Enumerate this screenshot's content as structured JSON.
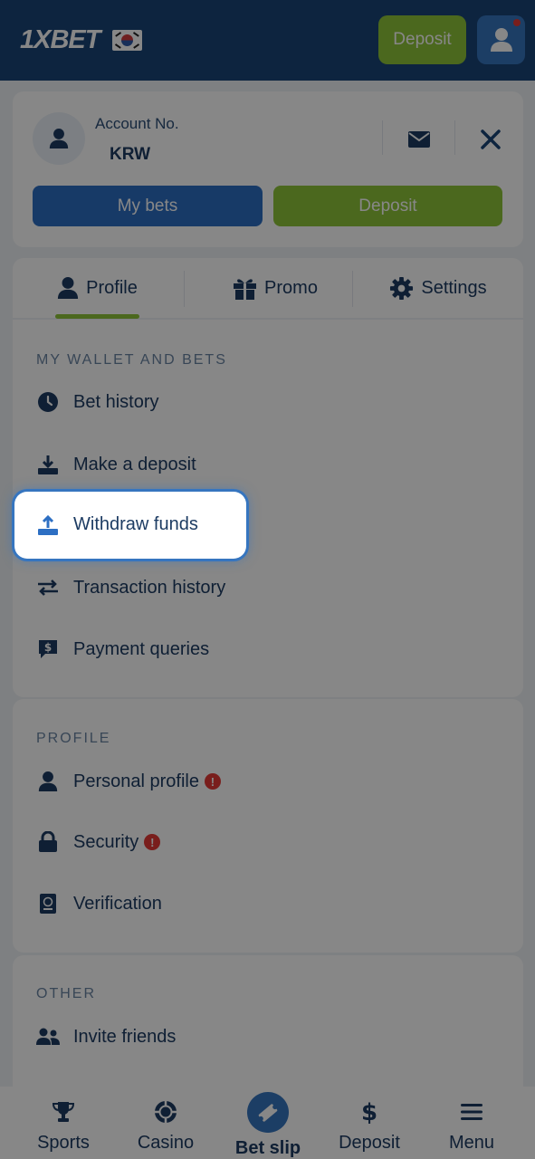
{
  "header": {
    "logo_text": "1XBET",
    "deposit_label": "Deposit"
  },
  "account": {
    "account_label": "Account No.",
    "currency": "KRW",
    "my_bets_label": "My bets",
    "deposit_label": "Deposit"
  },
  "tabs": [
    {
      "label": "Profile",
      "icon": "user-icon",
      "active": true
    },
    {
      "label": "Promo",
      "icon": "gift-icon"
    },
    {
      "label": "Settings",
      "icon": "gear-icon"
    }
  ],
  "wallet": {
    "title": "MY WALLET AND BETS",
    "items": [
      {
        "label": "Bet history",
        "icon": "clock-icon"
      },
      {
        "label": "Make a deposit",
        "icon": "download-icon"
      },
      {
        "label": "Withdraw funds",
        "icon": "upload-icon",
        "highlighted": true
      },
      {
        "label": "Transaction history",
        "icon": "arrows-exchange-icon"
      },
      {
        "label": "Payment queries",
        "icon": "dollar-chat-icon"
      }
    ]
  },
  "profile": {
    "title": "PROFILE",
    "items": [
      {
        "label": "Personal profile",
        "icon": "person-icon",
        "warning": true
      },
      {
        "label": "Security",
        "icon": "lock-icon",
        "warning": true
      },
      {
        "label": "Verification",
        "icon": "passport-icon"
      }
    ]
  },
  "other": {
    "title": "OTHER",
    "items": [
      {
        "label": "Invite friends",
        "icon": "users-icon"
      }
    ]
  },
  "bottom_nav": [
    {
      "label": "Sports",
      "icon": "trophy-icon"
    },
    {
      "label": "Casino",
      "icon": "chip-icon"
    },
    {
      "label": "Bet slip",
      "icon": "ticket-icon"
    },
    {
      "label": "Deposit",
      "icon": "dollar-icon"
    },
    {
      "label": "Menu",
      "icon": "hamburger-icon"
    }
  ],
  "colors": {
    "header_bg": "#1a4477",
    "accent_green": "#8fc53a",
    "accent_blue": "#2d6fc3",
    "warning_red": "#e53935"
  }
}
